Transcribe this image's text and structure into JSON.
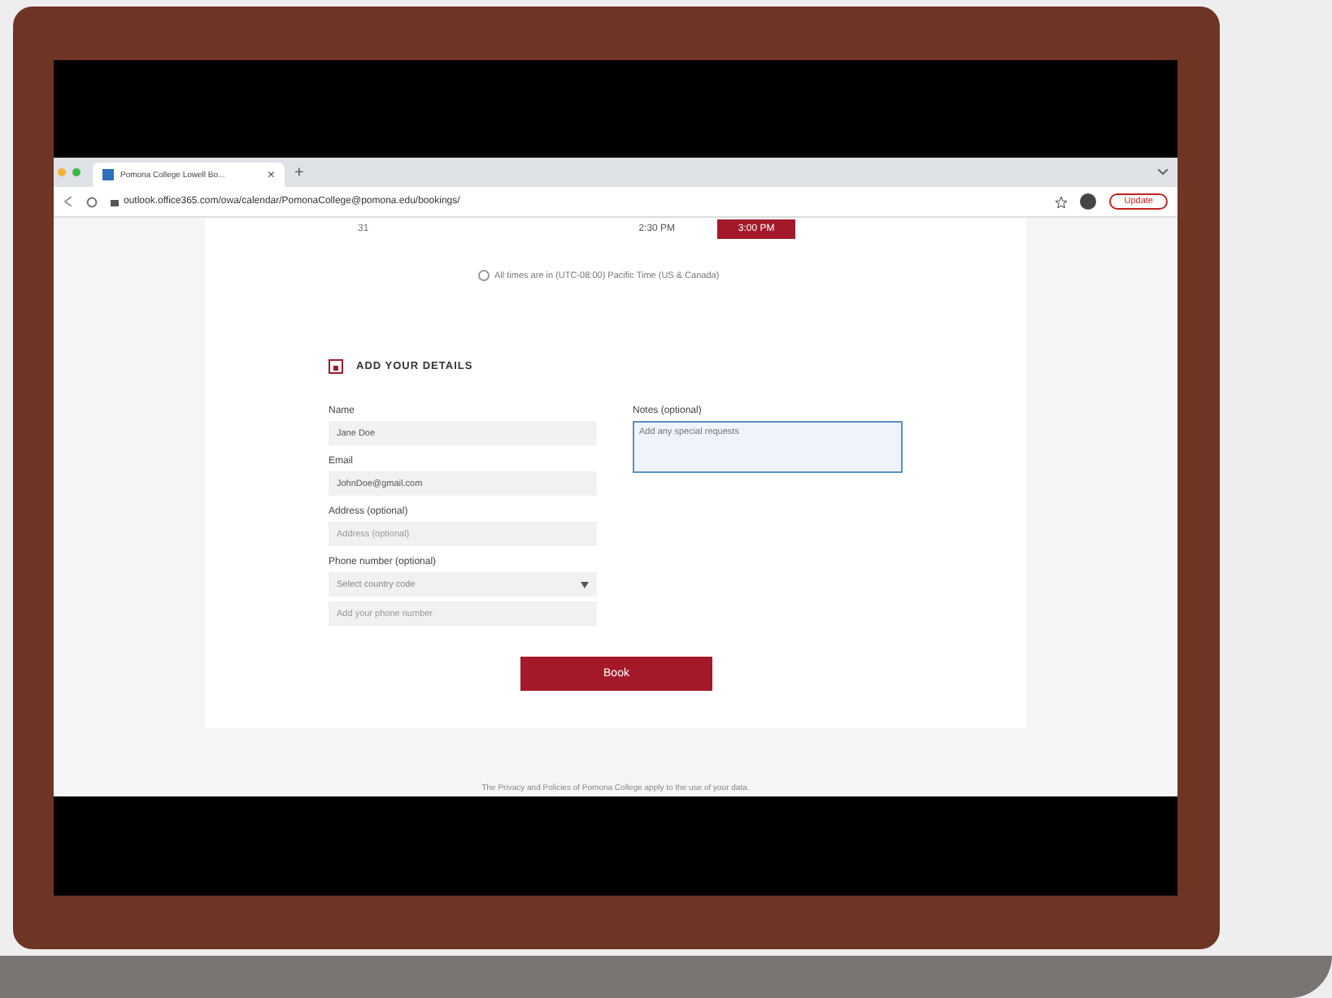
{
  "browser": {
    "tab_title": "Pomona College Lowell Bo...",
    "tab_close": "×",
    "new_tab": "+",
    "url": "outlook.office365.com/owa/calendar/PomonaCollege@pomona.edu/bookings/",
    "update_button": "Update"
  },
  "time_slots": {
    "day": "31",
    "times": [
      {
        "label": "2:30 PM",
        "selected": false
      },
      {
        "label": "3:00 PM",
        "selected": true
      }
    ],
    "timezone": "All times are in (UTC-08:00) Pacific Time (US & Canada)"
  },
  "details": {
    "heading": "ADD YOUR DETAILS",
    "fields": [
      {
        "kind": "text",
        "label": "Name",
        "value": "Jane Doe"
      },
      {
        "kind": "text",
        "label": "Email",
        "value": "JohnDoe@gmail.com"
      },
      {
        "kind": "text",
        "label": "Address (optional)",
        "placeholder": "Address (optional)"
      },
      {
        "kind": "select",
        "label": "Phone number (optional)",
        "value": "Select country code"
      },
      {
        "kind": "text",
        "placeholder": "Add your phone number"
      }
    ],
    "notes": {
      "label": "Notes (optional)",
      "placeholder": "Add any special requests",
      "focused": true
    },
    "book_button": "Book"
  },
  "footer": "The Privacy and Policies of Pomona College apply to the use of your data."
}
